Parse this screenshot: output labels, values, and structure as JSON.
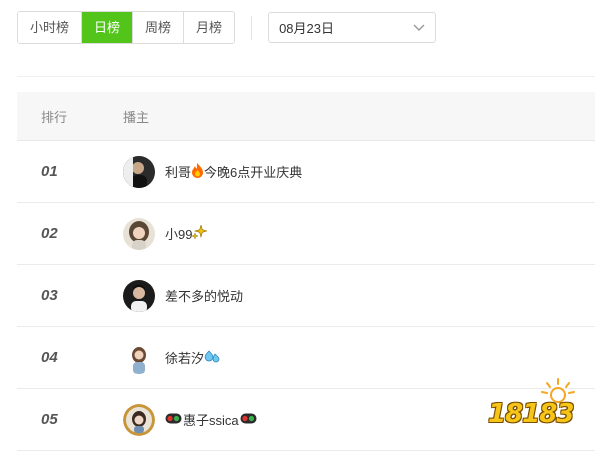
{
  "tabs": [
    {
      "label": "小时榜",
      "active": false
    },
    {
      "label": "日榜",
      "active": true
    },
    {
      "label": "周榜",
      "active": false
    },
    {
      "label": "月榜",
      "active": false
    }
  ],
  "date_picker": {
    "value": "08月23日",
    "icon": "chevron-down-icon"
  },
  "table": {
    "headers": {
      "rank": "排行",
      "anchor": "播主"
    },
    "rows": [
      {
        "rank": "01",
        "name_before": "利哥",
        "emoji_mid": "fire",
        "name_after": "今晚6点开业庆典",
        "emoji_end": ""
      },
      {
        "rank": "02",
        "name_before": "小99",
        "emoji_mid": "",
        "name_after": "",
        "emoji_end": "sparkle"
      },
      {
        "rank": "03",
        "name_before": "差不多的悦动",
        "emoji_mid": "",
        "name_after": "",
        "emoji_end": ""
      },
      {
        "rank": "04",
        "name_before": "徐若汐",
        "emoji_mid": "",
        "name_after": "",
        "emoji_end": "droplets"
      },
      {
        "rank": "05",
        "name_before": "惠子ssica",
        "emoji_mid": "",
        "name_after": "",
        "emoji_end": "traffic-light"
      }
    ]
  },
  "watermark": {
    "text": "18183"
  },
  "colors": {
    "accent": "#52c41a",
    "header_bg": "#f7f7f7"
  }
}
